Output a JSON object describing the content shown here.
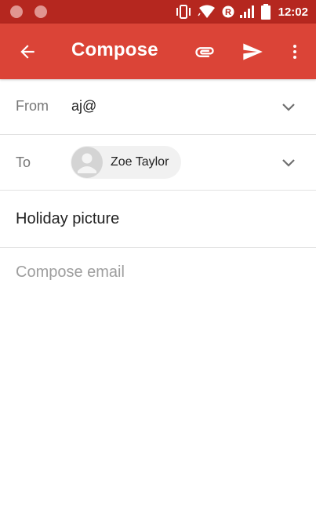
{
  "status_bar": {
    "time": "12:02",
    "icons": [
      "notification-dot-icon",
      "notification-dot-icon",
      "vibrate-icon",
      "wifi-icon",
      "roaming-icon",
      "signal-icon",
      "battery-icon"
    ]
  },
  "app_bar": {
    "title": "Compose",
    "icons": [
      "back-arrow-icon",
      "attach-icon",
      "send-icon",
      "more-vert-icon"
    ],
    "color": "#db4437",
    "status_color": "#b5271f"
  },
  "form": {
    "from": {
      "label": "From",
      "value": "aj@"
    },
    "to": {
      "label": "To",
      "recipient": "Zoe Taylor"
    },
    "subject": "Holiday picture",
    "body_placeholder": "Compose email"
  }
}
